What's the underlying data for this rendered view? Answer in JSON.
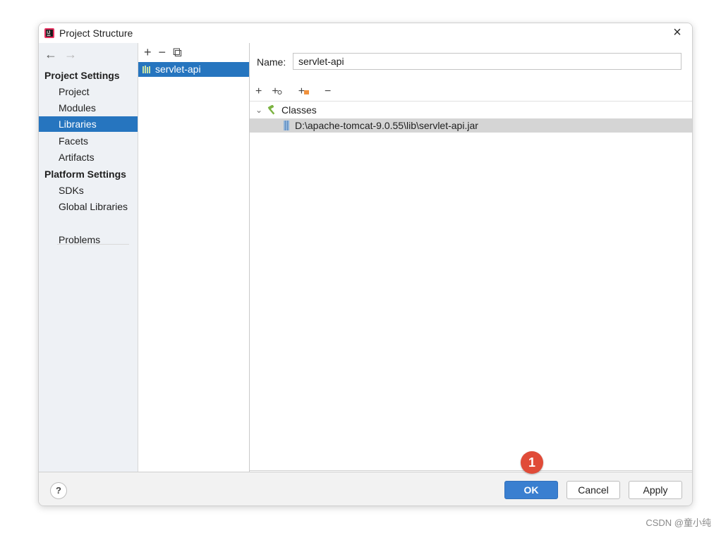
{
  "window": {
    "title": "Project Structure",
    "close_glyph": "×"
  },
  "nav": {
    "back": "←",
    "forward": "→"
  },
  "sidebar": {
    "project_settings_header": "Project Settings",
    "project_items": [
      "Project",
      "Modules",
      "Libraries",
      "Facets",
      "Artifacts"
    ],
    "platform_settings_header": "Platform Settings",
    "platform_items": [
      "SDKs",
      "Global Libraries"
    ],
    "problems": "Problems",
    "selected": "Libraries"
  },
  "library_list": {
    "toolbar": {
      "add": "+",
      "remove": "−",
      "copy": "⧉"
    },
    "items": [
      "servlet-api"
    ]
  },
  "detail": {
    "name_label": "Name:",
    "name_value": "servlet-api",
    "toolbar": {
      "add": "+",
      "add_alt": "+",
      "add_folder": "+",
      "remove": "−"
    },
    "tree": {
      "chevron": "⌄",
      "root_label": "Classes",
      "child_path": "D:\\apache-tomcat-9.0.55\\lib\\servlet-api.jar"
    }
  },
  "footer": {
    "help": "?",
    "ok": "OK",
    "cancel": "Cancel",
    "apply": "Apply"
  },
  "annotation": {
    "marker": "1",
    "color": "#e04b38"
  },
  "watermark": "CSDN @童小纯",
  "colors": {
    "selection": "#2675bf",
    "ok_button": "#3a7fd0",
    "sidebar_bg": "#eef1f5"
  }
}
